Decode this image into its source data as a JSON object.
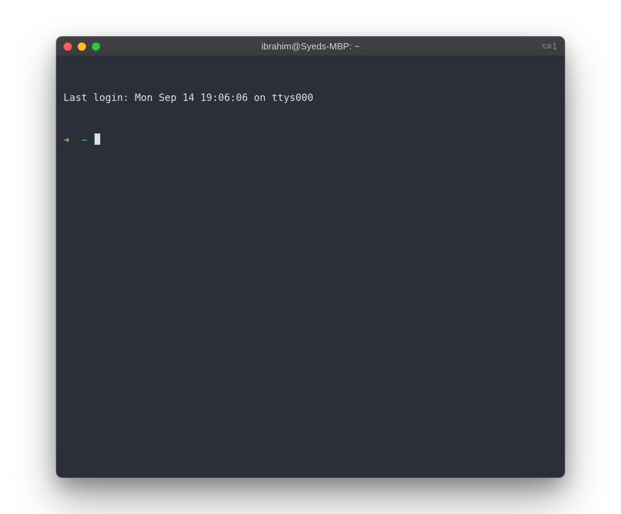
{
  "window": {
    "title": "ibrahim@Syeds-MBP: ~",
    "tab_indicator": "⌥⌘1"
  },
  "terminal": {
    "last_login": "Last login: Mon Sep 14 19:06:06 on ttys000",
    "prompt": {
      "arrow": "➜",
      "path": "~"
    }
  }
}
